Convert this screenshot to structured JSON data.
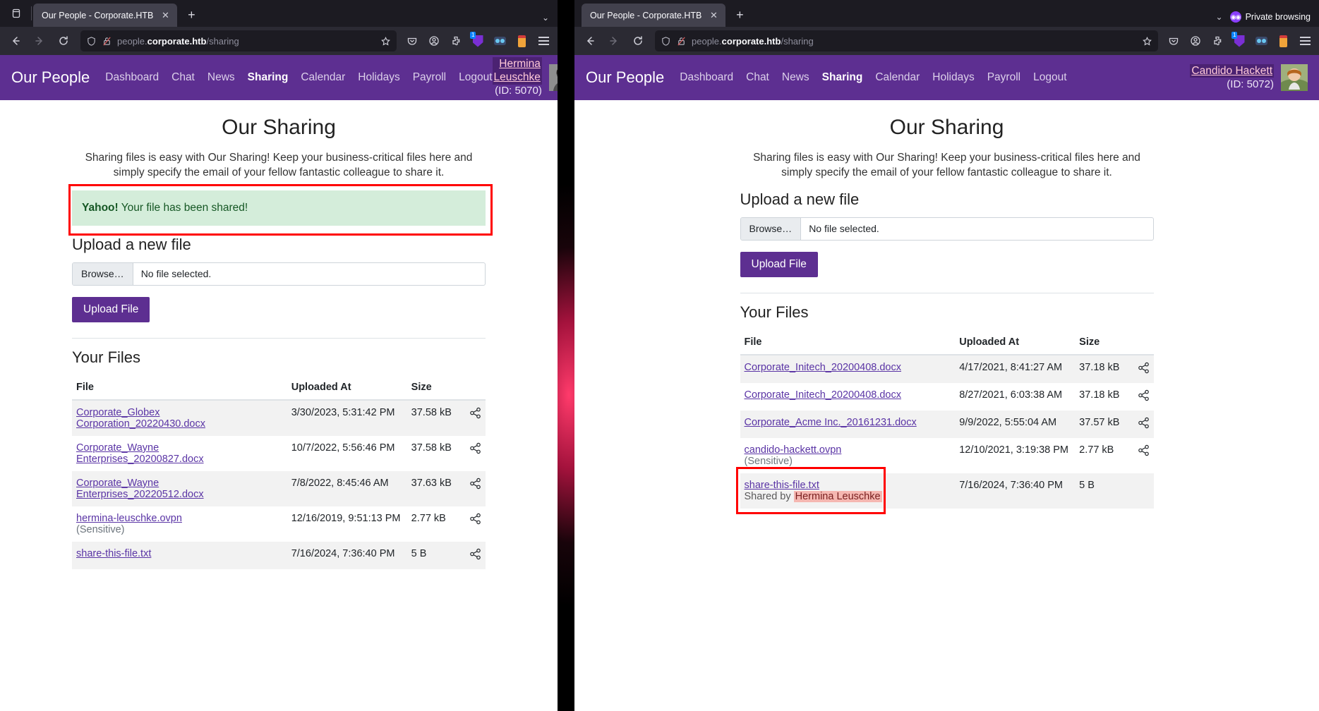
{
  "windows": {
    "left": {
      "browser": {
        "tab_title": "Our People - Corporate.HTB",
        "close_glyph": "✕",
        "newtab_glyph": "+",
        "chevron_glyph": "⌄",
        "url_display_pre": "people.",
        "url_display_host": "corporate.htb",
        "url_display_path": "/sharing",
        "ext_badge_count": "1"
      },
      "site": {
        "brand": "Our People",
        "nav": [
          {
            "label": "Dashboard",
            "active": false
          },
          {
            "label": "Chat",
            "active": false
          },
          {
            "label": "News",
            "active": false
          },
          {
            "label": "Sharing",
            "active": true
          },
          {
            "label": "Calendar",
            "active": false
          },
          {
            "label": "Holidays",
            "active": false
          },
          {
            "label": "Payroll",
            "active": false
          },
          {
            "label": "Logout",
            "active": false
          }
        ],
        "user_name": "Hermina Leuschke",
        "user_id": "(ID: 5070)"
      },
      "page": {
        "title": "Our Sharing",
        "lede": "Sharing files is easy with Our Sharing! Keep your business-critical files here and simply specify the email of your fellow fantastic colleague to share it.",
        "alert": {
          "strong": "Yahoo!",
          "text": " Your file has been shared!"
        },
        "upload_heading": "Upload a new file",
        "browse_label": "Browse…",
        "no_file_label": "No file selected.",
        "upload_button": "Upload File",
        "files_heading": "Your Files",
        "columns": [
          "File",
          "Uploaded At",
          "Size"
        ],
        "rows": [
          {
            "name": "Corporate_Globex Corporation_20220430.docx",
            "note": "",
            "shared_by": "",
            "date": "3/30/2023, 5:31:42 PM",
            "size": "37.58 kB",
            "link": true
          },
          {
            "name": "Corporate_Wayne Enterprises_20200827.docx",
            "note": "",
            "shared_by": "",
            "date": "10/7/2022, 5:56:46 PM",
            "size": "37.58 kB",
            "link": true
          },
          {
            "name": "Corporate_Wayne Enterprises_20220512.docx",
            "note": "",
            "shared_by": "",
            "date": "7/8/2022, 8:45:46 AM",
            "size": "37.63 kB",
            "link": true
          },
          {
            "name": "hermina-leuschke.ovpn",
            "note": "(Sensitive)",
            "shared_by": "",
            "date": "12/16/2019, 9:51:13 PM",
            "size": "2.77 kB",
            "link": true
          },
          {
            "name": "share-this-file.txt",
            "note": "",
            "shared_by": "",
            "date": "7/16/2024, 7:36:40 PM",
            "size": "5 B",
            "link": true
          }
        ]
      }
    },
    "right": {
      "browser": {
        "tab_title": "Our People - Corporate.HTB",
        "close_glyph": "✕",
        "newtab_glyph": "+",
        "chevron_glyph": "⌄",
        "private_label": "Private browsing",
        "url_display_pre": "people.",
        "url_display_host": "corporate.htb",
        "url_display_path": "/sharing",
        "ext_badge_count": "1"
      },
      "site": {
        "brand": "Our People",
        "nav": [
          {
            "label": "Dashboard",
            "active": false
          },
          {
            "label": "Chat",
            "active": false
          },
          {
            "label": "News",
            "active": false
          },
          {
            "label": "Sharing",
            "active": true
          },
          {
            "label": "Calendar",
            "active": false
          },
          {
            "label": "Holidays",
            "active": false
          },
          {
            "label": "Payroll",
            "active": false
          },
          {
            "label": "Logout",
            "active": false
          }
        ],
        "user_name": "Candido Hackett",
        "user_id": "(ID: 5072)"
      },
      "page": {
        "title": "Our Sharing",
        "lede": "Sharing files is easy with Our Sharing! Keep your business-critical files here and simply specify the email of your fellow fantastic colleague to share it.",
        "upload_heading": "Upload a new file",
        "browse_label": "Browse…",
        "no_file_label": "No file selected.",
        "upload_button": "Upload File",
        "files_heading": "Your Files",
        "columns": [
          "File",
          "Uploaded At",
          "Size"
        ],
        "rows": [
          {
            "name": "Corporate_Initech_20200408.docx",
            "note": "",
            "shared_by": "",
            "date": "4/17/2021, 8:41:27 AM",
            "size": "37.18 kB",
            "link": true
          },
          {
            "name": "Corporate_Initech_20200408.docx",
            "note": "",
            "shared_by": "",
            "date": "8/27/2021, 6:03:38 AM",
            "size": "37.18 kB",
            "link": true
          },
          {
            "name": "Corporate_Acme Inc._20161231.docx",
            "note": "",
            "shared_by": "",
            "date": "9/9/2022, 5:55:04 AM",
            "size": "37.57 kB",
            "link": true
          },
          {
            "name": "candido-hackett.ovpn",
            "note": "(Sensitive)",
            "shared_by": "",
            "date": "12/10/2021, 3:19:38 PM",
            "size": "2.77 kB",
            "link": true
          },
          {
            "name": "share-this-file.txt",
            "note": "",
            "shared_by_prefix": "Shared by ",
            "shared_by": "Hermina Leuschke",
            "date": "7/16/2024, 7:36:40 PM",
            "size": "5 B",
            "link": true,
            "highlight": true
          }
        ]
      }
    }
  },
  "colors": {
    "brand_purple": "#5d2f91",
    "link_purple": "#5a34a5",
    "alert_bg": "#d4edda",
    "alert_text": "#155724",
    "highlight_red": "#ff0000",
    "shared_mark": "#f5b7b1",
    "chrome_dark": "#2b2a33",
    "tabstrip_dark": "#1c1b22"
  }
}
